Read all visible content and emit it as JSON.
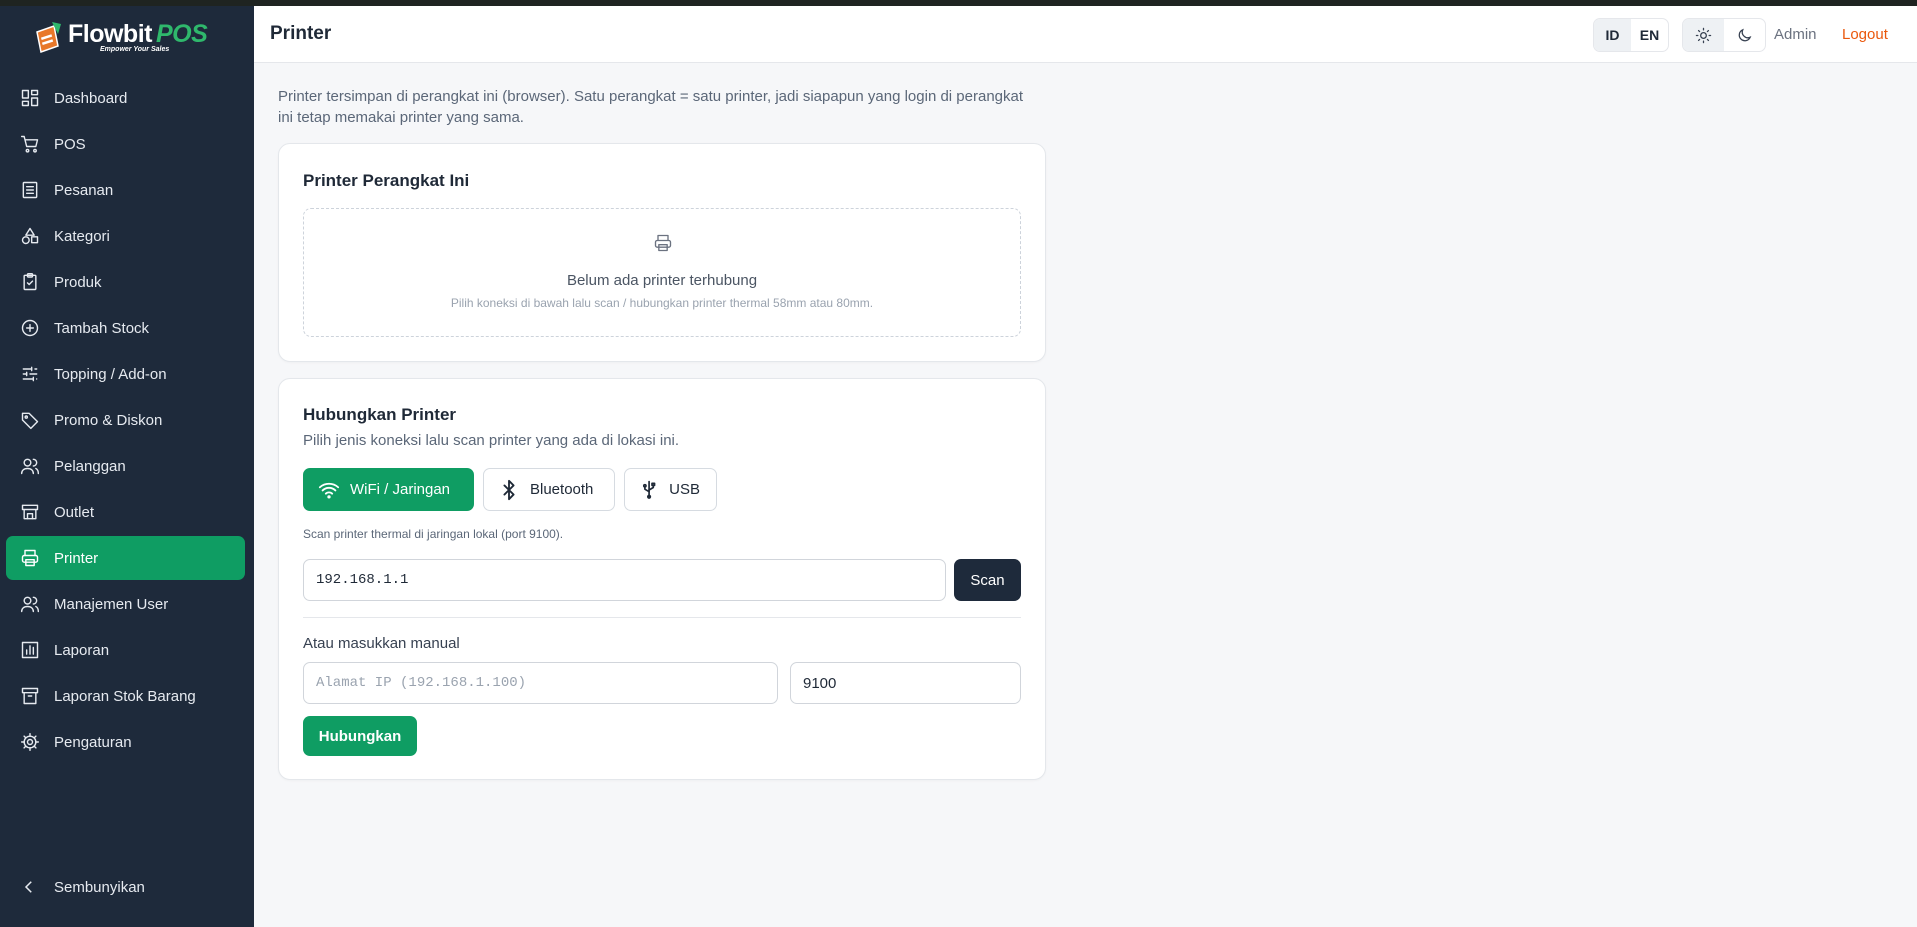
{
  "brand": {
    "name_main": "Flowbit",
    "name_accent": "POS",
    "tagline": "Empower Your Sales"
  },
  "sidebar": {
    "items": [
      {
        "label": "Dashboard",
        "icon": "dashboard-icon"
      },
      {
        "label": "POS",
        "icon": "cart-icon"
      },
      {
        "label": "Pesanan",
        "icon": "list-icon"
      },
      {
        "label": "Kategori",
        "icon": "shapes-icon"
      },
      {
        "label": "Produk",
        "icon": "clipboard-check-icon"
      },
      {
        "label": "Tambah Stock",
        "icon": "plus-circle-icon"
      },
      {
        "label": "Topping / Add-on",
        "icon": "sliders-icon"
      },
      {
        "label": "Promo & Diskon",
        "icon": "tag-icon"
      },
      {
        "label": "Pelanggan",
        "icon": "users-icon"
      },
      {
        "label": "Outlet",
        "icon": "store-icon"
      },
      {
        "label": "Printer",
        "icon": "printer-icon",
        "active": true
      },
      {
        "label": "Manajemen User",
        "icon": "users-icon"
      },
      {
        "label": "Laporan",
        "icon": "bar-chart-icon"
      },
      {
        "label": "Laporan Stok Barang",
        "icon": "archive-icon"
      },
      {
        "label": "Pengaturan",
        "icon": "gear-icon"
      }
    ],
    "collapse_label": "Sembunyikan"
  },
  "header": {
    "title": "Printer",
    "languages": [
      "ID",
      "EN"
    ],
    "active_language": "ID",
    "theme_options": [
      "sun-icon",
      "moon-icon"
    ],
    "active_theme": "light",
    "user": "Admin",
    "logout_label": "Logout"
  },
  "main": {
    "intro": "Printer tersimpan di perangkat ini (browser). Satu perangkat = satu printer, jadi siapapun yang login di perangkat ini tetap memakai printer yang sama.",
    "device_card": {
      "title": "Printer Perangkat Ini",
      "empty_title": "Belum ada printer terhubung",
      "empty_subtitle": "Pilih koneksi di bawah lalu scan / hubungkan printer thermal 58mm atau 80mm."
    },
    "connect_card": {
      "title": "Hubungkan Printer",
      "subtitle": "Pilih jenis koneksi lalu scan printer yang ada di lokasi ini.",
      "tabs": [
        {
          "label": "WiFi / Jaringan",
          "icon": "wifi-icon",
          "active": true
        },
        {
          "label": "Bluetooth",
          "icon": "bluetooth-icon"
        },
        {
          "label": "USB",
          "icon": "usb-icon"
        }
      ],
      "scan_hint": "Scan printer thermal di jaringan lokal (port 9100).",
      "subnet_value": "192.168.1.1",
      "scan_label": "Scan",
      "manual_label": "Atau masukkan manual",
      "manual_ip_placeholder": "Alamat IP (192.168.1.100)",
      "port_value": "9100",
      "connect_label": "Hubungkan"
    }
  },
  "colors": {
    "sidebar_bg": "#1e2a3b",
    "accent_green": "#0f9d63",
    "logout_orange": "#ea580c",
    "dark_button": "#1e2a3b"
  }
}
